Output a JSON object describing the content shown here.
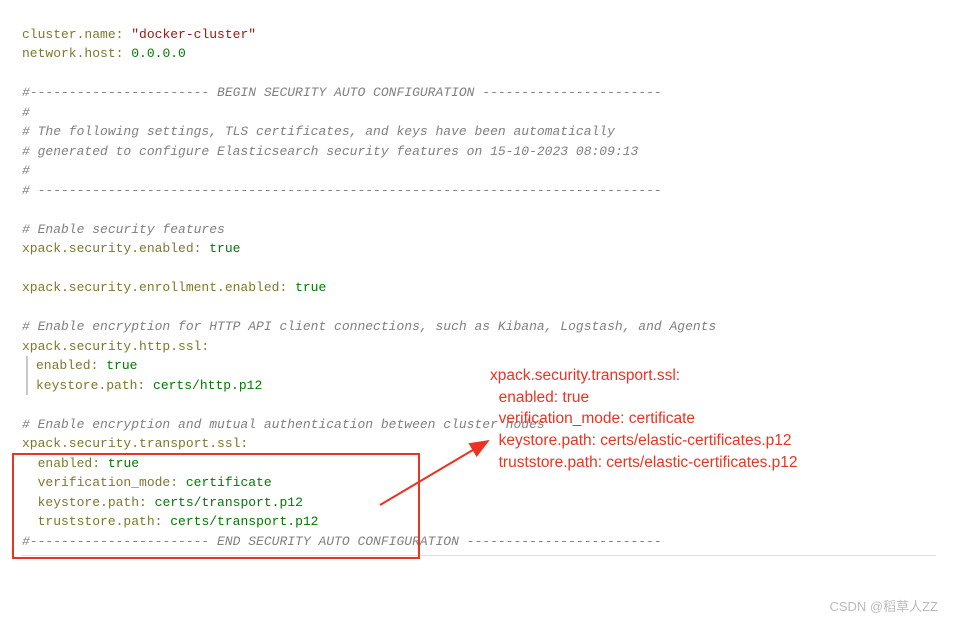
{
  "yaml": {
    "line1_key": "cluster.name:",
    "line1_val": "\"docker-cluster\"",
    "line2_key": "network.host:",
    "line2_val": "0.0.0.0",
    "line3": "",
    "c1": "#----------------------- BEGIN SECURITY AUTO CONFIGURATION -----------------------",
    "c2": "#",
    "c3": "# The following settings, TLS certificates, and keys have been automatically",
    "c4": "# generated to configure Elasticsearch security features on 15-10-2023 08:09:13",
    "c5": "#",
    "c6": "# --------------------------------------------------------------------------------",
    "c7": "",
    "c8": "# Enable security features",
    "se_key": "xpack.security.enabled:",
    "se_val": "true",
    "see_key": "xpack.security.enrollment.enabled:",
    "see_val": "true",
    "c9": "# Enable encryption for HTTP API client connections, such as Kibana, Logstash, and Agents",
    "http_key": "xpack.security.http.ssl:",
    "http_en_key": "enabled:",
    "http_en_val": "true",
    "http_ks_key": "keystore.path:",
    "http_ks_val": "certs/http.p12",
    "c10": "# Enable encryption and mutual authentication between cluster nodes",
    "trans_key": "xpack.security.transport.ssl:",
    "trans_en_key": "enabled:",
    "trans_en_val": "true",
    "trans_vm_key": "verification_mode:",
    "trans_vm_val": "certificate",
    "trans_ks_key": "keystore.path:",
    "trans_ks_val": "certs/transport.p12",
    "trans_ts_key": "truststore.path:",
    "trans_ts_val": "certs/transport.p12",
    "c11": "#----------------------- END SECURITY AUTO CONFIGURATION -------------------------"
  },
  "annotation": {
    "l1": "xpack.security.transport.ssl:",
    "l2": "  enabled: true",
    "l3": "  verification_mode: certificate",
    "l4": "  keystore.path: certs/elastic-certificates.p12",
    "l5": "  truststore.path: certs/elastic-certificates.p12"
  },
  "watermark": "CSDN @稻草人ZZ"
}
